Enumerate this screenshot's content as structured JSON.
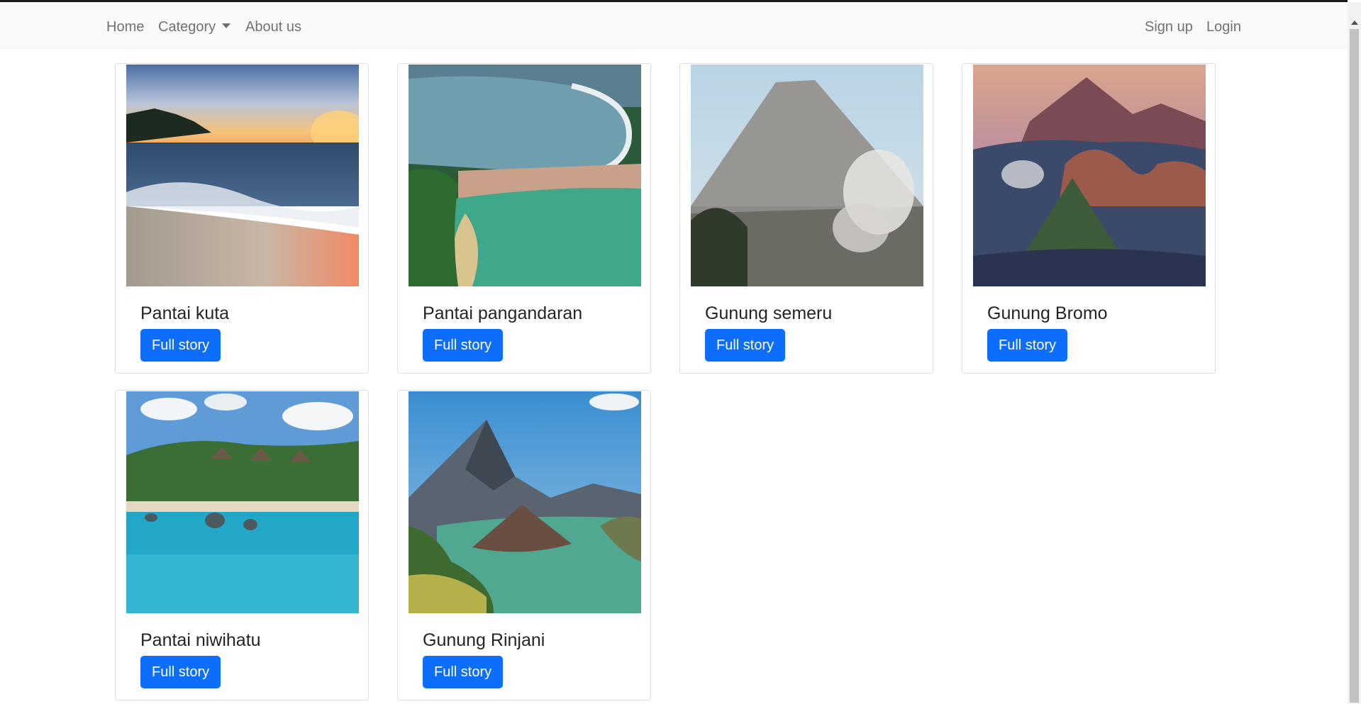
{
  "navbar": {
    "home": "Home",
    "category": "Category",
    "about": "About us",
    "signup": "Sign up",
    "login": "Login"
  },
  "cards": [
    {
      "title": "Pantai kuta",
      "button": "Full story"
    },
    {
      "title": "Pantai pangandaran",
      "button": "Full story"
    },
    {
      "title": "Gunung semeru",
      "button": "Full story"
    },
    {
      "title": "Gunung Bromo",
      "button": "Full story"
    },
    {
      "title": "Pantai niwihatu",
      "button": "Full story"
    },
    {
      "title": "Gunung Rinjani",
      "button": "Full story"
    }
  ],
  "colors": {
    "primary": "#0d6efd",
    "navbar_bg": "#f8f9fa",
    "nav_text": "#6c6c6c"
  }
}
